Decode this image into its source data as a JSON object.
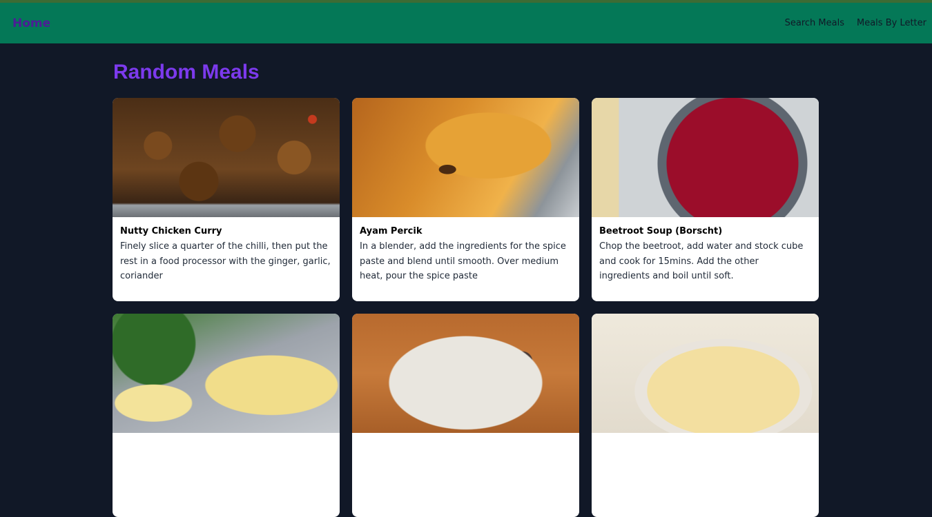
{
  "nav": {
    "home": "Home",
    "links": [
      "Search Meals",
      "Meals By Letter"
    ]
  },
  "page": {
    "title": "Random Meals"
  },
  "meals": [
    {
      "title": "Nutty Chicken Curry",
      "description": "Finely slice a quarter of the chilli, then put the rest in a food processor with the ginger, garlic, coriander"
    },
    {
      "title": "Ayam Percik",
      "description": "In a blender, add the ingredients for the spice paste and blend until smooth. Over medium heat, pour the spice paste"
    },
    {
      "title": "Beetroot Soup (Borscht)",
      "description": "Chop the beetroot, add water and stock cube and cook for 15mins. Add the other ingredients and boil until soft."
    },
    {
      "title": "",
      "description": ""
    },
    {
      "title": "",
      "description": ""
    },
    {
      "title": "",
      "description": ""
    }
  ],
  "colors": {
    "header_bg": "#047857",
    "page_bg": "#111827",
    "title": "#7c3aed",
    "home_link": "#4c1d95"
  }
}
